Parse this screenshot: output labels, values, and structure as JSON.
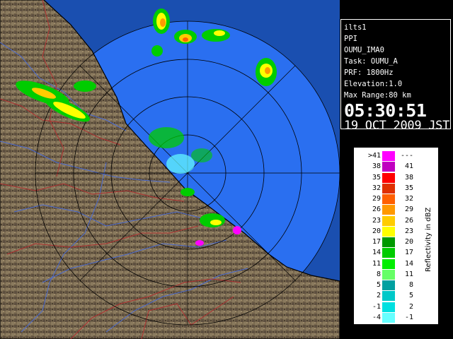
{
  "info": {
    "station": "ilts1",
    "scan_type": "PPI",
    "site": "OUMU_IMA0",
    "task": "Task: OUMU_A",
    "prf": "PRF: 1800Hz",
    "elevation": "Elevation:1.0",
    "max_range": "Max Range:80 km",
    "time": "05:30:51",
    "date": "19 OCT 2009 JST"
  },
  "legend": {
    "title": "Reflectivity in dBZ",
    "rows": [
      {
        "low": ">41",
        "high": "---",
        "color": "#ff00ff"
      },
      {
        "low": "38",
        "high": "41",
        "color": "#c000c0"
      },
      {
        "low": "35",
        "high": "38",
        "color": "#ff0000"
      },
      {
        "low": "32",
        "high": "35",
        "color": "#e03000"
      },
      {
        "low": "29",
        "high": "32",
        "color": "#ff6000"
      },
      {
        "low": "26",
        "high": "29",
        "color": "#ff9900"
      },
      {
        "low": "23",
        "high": "26",
        "color": "#ffcc00"
      },
      {
        "low": "20",
        "high": "23",
        "color": "#ffff00"
      },
      {
        "low": "17",
        "high": "20",
        "color": "#009900"
      },
      {
        "low": "14",
        "high": "17",
        "color": "#00cc00"
      },
      {
        "low": "11",
        "high": "14",
        "color": "#00ee00"
      },
      {
        "low": "8",
        "high": "11",
        "color": "#66ff66"
      },
      {
        "low": "5",
        "high": "8",
        "color": "#00a0a0"
      },
      {
        "low": "2",
        "high": "5",
        "color": "#00c8c8"
      },
      {
        "low": "-1",
        "high": "2",
        "color": "#00e0e0"
      },
      {
        "low": "-4",
        "high": "-1",
        "color": "#66ffff"
      }
    ]
  },
  "colors": {
    "sea": "#2a6ff0",
    "sea_outer": "#1a4fb0",
    "land": "#7a6a50",
    "range_ring": "#000000",
    "coastline": "#000000",
    "rivers": "#4a6ad0",
    "boundaries": "#b03030"
  }
}
